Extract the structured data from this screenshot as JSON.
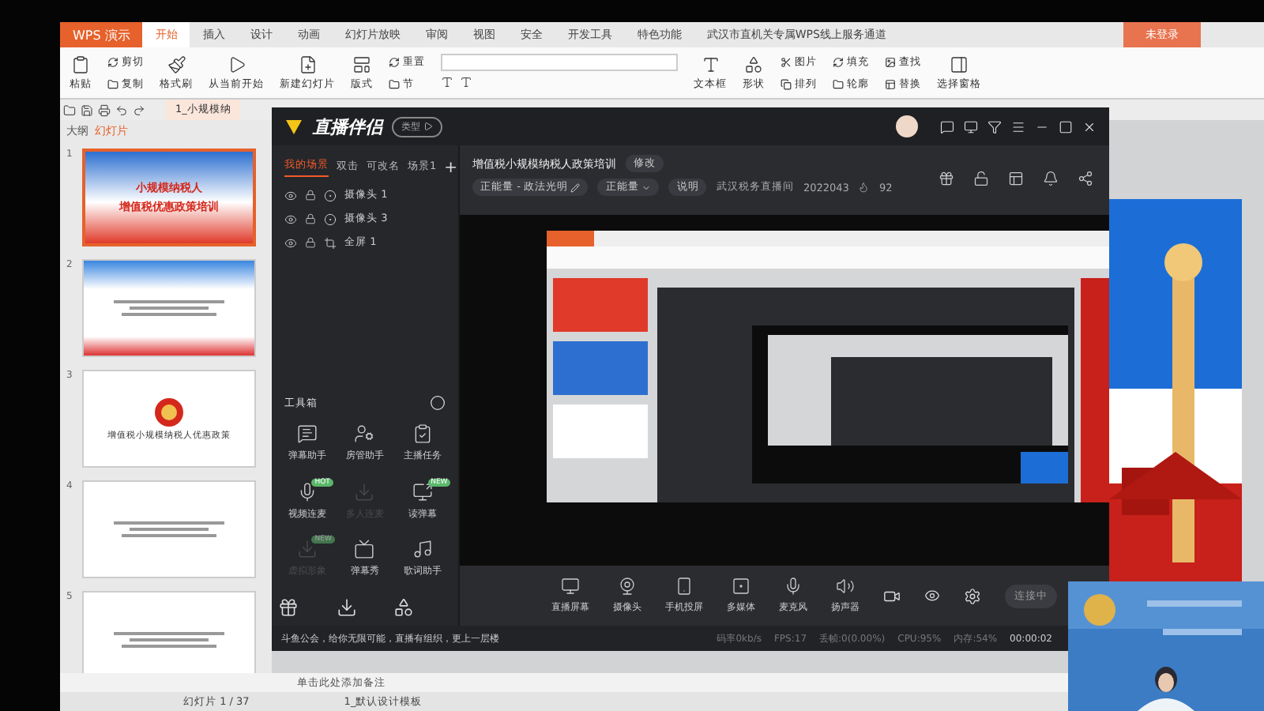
{
  "wps": {
    "app_menu": "WPS 演示",
    "tabs": [
      {
        "label": "开始",
        "selected": true
      },
      {
        "label": "插入",
        "selected": false
      },
      {
        "label": "设计",
        "selected": false
      },
      {
        "label": "动画",
        "selected": false
      },
      {
        "label": "幻灯片放映",
        "selected": false
      },
      {
        "label": "审阅",
        "selected": false
      },
      {
        "label": "视图",
        "selected": false
      },
      {
        "label": "安全",
        "selected": false
      },
      {
        "label": "开发工具",
        "selected": false
      },
      {
        "label": "特色功能",
        "selected": false
      },
      {
        "label": "武汉市直机关专属WPS线上服务通道",
        "selected": false
      }
    ],
    "login_button": "未登录",
    "ribbon": [
      {
        "kind": "big",
        "label": "粘贴"
      },
      {
        "kind": "pair",
        "items": [
          "剪切",
          "复制"
        ]
      },
      {
        "kind": "big",
        "label": "格式刷"
      },
      {
        "kind": "big",
        "label": "从当前开始"
      },
      {
        "kind": "big",
        "label": "新建幻灯片"
      },
      {
        "kind": "big",
        "label": "版式"
      },
      {
        "kind": "pair",
        "items": [
          "重置",
          "节"
        ]
      },
      {
        "kind": "font"
      },
      {
        "kind": "big",
        "label": "文本框"
      },
      {
        "kind": "big",
        "label": "形状"
      },
      {
        "kind": "pair",
        "items": [
          "图片",
          "排列"
        ]
      },
      {
        "kind": "pair",
        "items": [
          "填充",
          "轮廓"
        ]
      },
      {
        "kind": "pair",
        "items": [
          "查找",
          "替换"
        ]
      },
      {
        "kind": "big",
        "label": "选择窗格"
      }
    ],
    "doc_tab": "1_小规模纳",
    "pane_tabs": [
      {
        "label": "大纲",
        "selected": false
      },
      {
        "label": "幻灯片",
        "selected": true
      }
    ],
    "slides": [
      {
        "number": "1",
        "selected": true,
        "kind": "cover",
        "title": "小规模纳税人",
        "subtitle": "增值税优惠政策培训"
      },
      {
        "number": "2",
        "selected": false,
        "kind": "list"
      },
      {
        "number": "3",
        "selected": false,
        "kind": "emblem",
        "title": "增值税小规模纳税人优惠政策"
      },
      {
        "number": "4",
        "selected": false,
        "kind": "text"
      },
      {
        "number": "5",
        "selected": false,
        "kind": "text"
      }
    ],
    "notes_placeholder": "单击此处添加备注",
    "status": {
      "slide_count": "幻灯片 1 / 37",
      "template": "1_默认设计模板"
    }
  },
  "live": {
    "logo": "直播伴侣",
    "type_button": "类型",
    "scene_tabs": [
      {
        "label": "我的场景",
        "selected": true
      },
      {
        "label": "双击",
        "selected": false
      },
      {
        "label": "可改名",
        "selected": false
      },
      {
        "label": "场景1",
        "selected": false
      }
    ],
    "add_scene": "+",
    "sources": [
      {
        "kind": "camera",
        "label": "摄像头 1"
      },
      {
        "kind": "camera",
        "label": "摄像头 3"
      },
      {
        "kind": "screen",
        "label": "全屏 1"
      }
    ],
    "title": "增值税小规模纳税人政策培训",
    "edit_button": "修改",
    "category": "正能量 - 政法光明",
    "tag": "正能量",
    "note_button": "说明",
    "room_name": "武汉税务直播间",
    "room_id": "2022043",
    "heat": "92",
    "toolbox_title": "工具箱",
    "tools": [
      {
        "label": "弹幕助手",
        "kind": "chat",
        "disabled": false
      },
      {
        "label": "房管助手",
        "kind": "user",
        "disabled": false
      },
      {
        "label": "主播任务",
        "kind": "task",
        "disabled": false
      },
      {
        "label": "视频连麦",
        "kind": "mic",
        "disabled": false,
        "badge": "HOT"
      },
      {
        "label": "多人连麦",
        "kind": "download",
        "disabled": true
      },
      {
        "label": "读弹幕",
        "kind": "screen",
        "disabled": false,
        "badge": "NEW"
      },
      {
        "label": "虚拟形象",
        "kind": "download",
        "disabled": true,
        "badge": "NEW"
      },
      {
        "label": "弹幕秀",
        "kind": "tv",
        "disabled": false
      },
      {
        "label": "歌词助手",
        "kind": "lyrics",
        "disabled": false
      }
    ],
    "controls": [
      {
        "label": "直播屏幕",
        "kind": "monitor"
      },
      {
        "label": "摄像头",
        "kind": "webcam"
      },
      {
        "label": "手机投屏",
        "kind": "phone"
      },
      {
        "label": "多媒体",
        "kind": "media"
      },
      {
        "label": "麦克风",
        "kind": "mic"
      },
      {
        "label": "扬声器",
        "kind": "speaker"
      }
    ],
    "connect_button": "连接中",
    "notice": "斗鱼公会，给你无限可能，直播有组织，更上一层楼",
    "stats": [
      "码率0kb/s",
      "FPS:17",
      "丢帧:0(0.00%)",
      "CPU:95%",
      "内存:54%"
    ],
    "duration": "00:00:02"
  }
}
